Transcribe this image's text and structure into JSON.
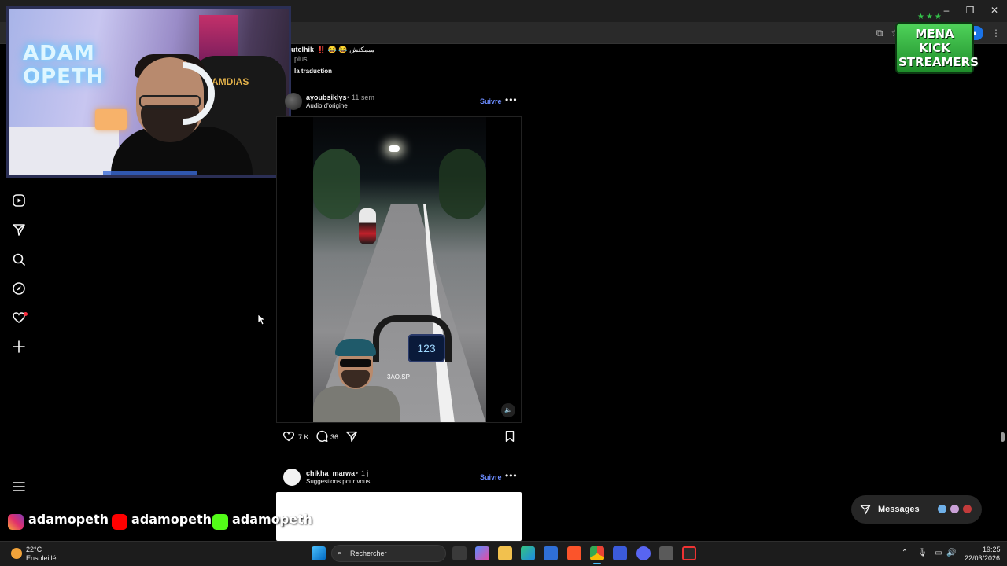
{
  "window": {
    "controls": [
      "–",
      "❐",
      "✕"
    ]
  },
  "webcam": {
    "neon_sign": "ADAM OPETH",
    "chair_brand": "AMDIAS"
  },
  "logo": {
    "text": "MENA KICK STREAMERS",
    "stars": "★★★"
  },
  "feed": {
    "prev_post": {
      "username_fragment": "utelhik",
      "caption": "‼️ 😂 😂 ميمكتش",
      "more": "plus",
      "translate": "la traduction"
    },
    "post1": {
      "username": "ayoubsiklys",
      "age": "11 sem",
      "audio": "Audio d'origine",
      "follow": "Suivre",
      "likes": "7 K",
      "comments": "36",
      "speed": "123",
      "plate": "3AO.SP"
    },
    "post2": {
      "username": "chikha_marwa",
      "age": "1 j",
      "subtitle": "Suggestions pour vous",
      "follow": "Suivre"
    },
    "dot": "•",
    "menu": "•••"
  },
  "messages": {
    "label": "Messages"
  },
  "social": {
    "instagram": "adamopeth",
    "youtube": "adamopeth",
    "kick": "adamopeth"
  },
  "taskbar": {
    "temperature": "22°C",
    "condition": "Ensoleillé",
    "search_placeholder": "Rechercher",
    "time": "19:25",
    "date": "22/03/2026"
  }
}
